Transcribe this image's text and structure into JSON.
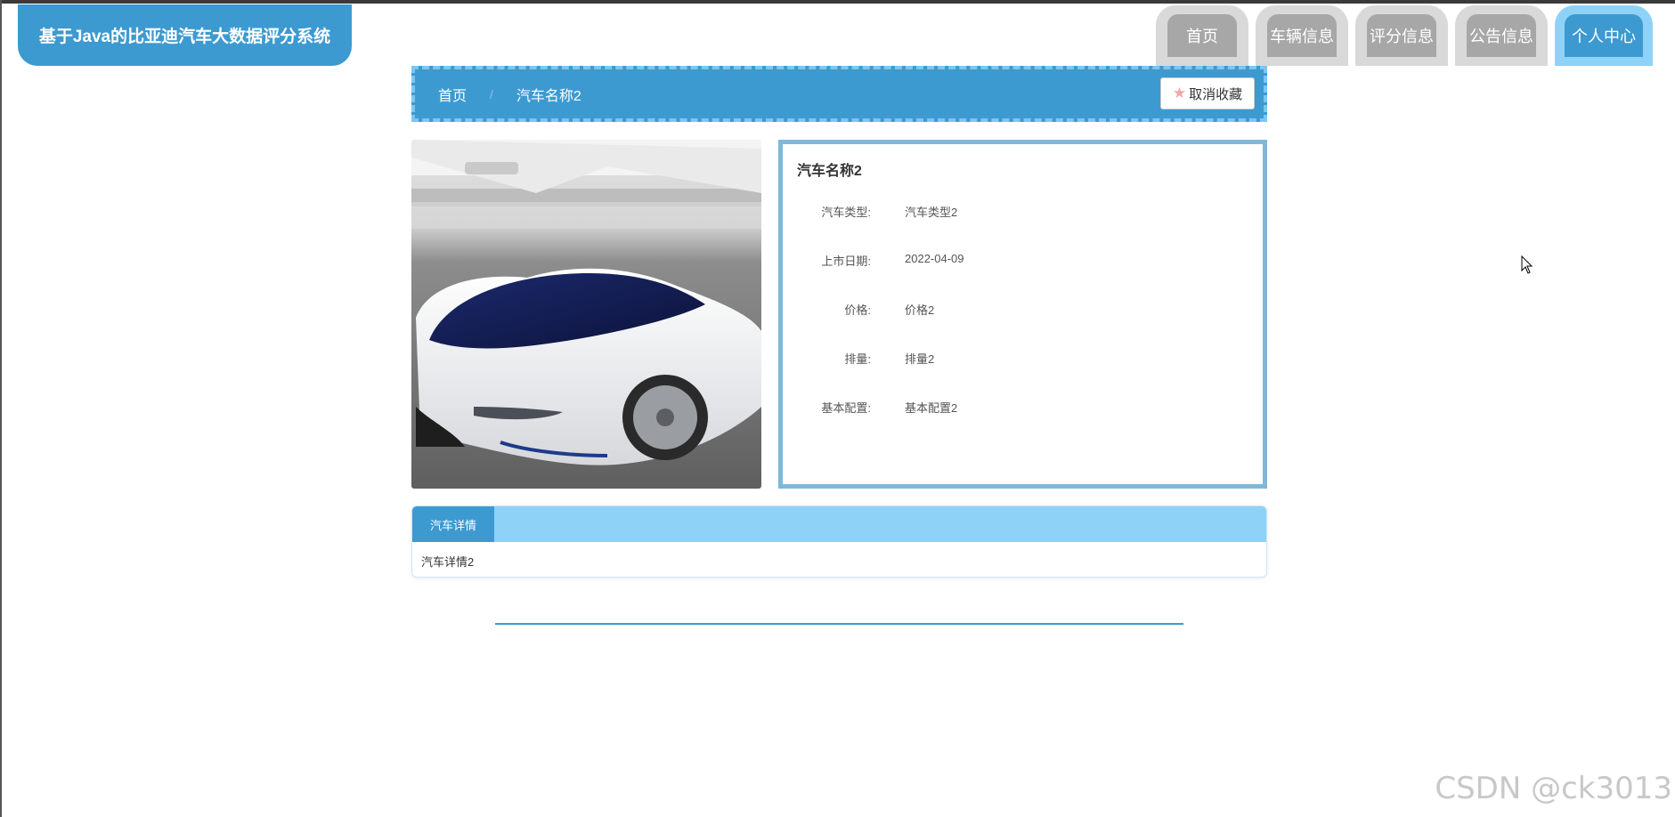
{
  "header": {
    "site_title": "基于Java的比亚迪汽车大数据评分系统",
    "nav": [
      {
        "label": "首页",
        "active": false
      },
      {
        "label": "车辆信息",
        "active": false
      },
      {
        "label": "评分信息",
        "active": false
      },
      {
        "label": "公告信息",
        "active": false
      },
      {
        "label": "个人中心",
        "active": true
      }
    ]
  },
  "breadcrumb": {
    "home": "首页",
    "separator": "/",
    "current": "汽车名称2",
    "favorite_button": "取消收藏",
    "favorite_icon": "star-icon"
  },
  "car": {
    "name": "汽车名称2",
    "image_alt": "white concept sports car",
    "fields": [
      {
        "label": "汽车类型:",
        "value": "汽车类型2"
      },
      {
        "label": "上市日期:",
        "value": "2022-04-09"
      },
      {
        "label": "价格:",
        "value": "价格2"
      },
      {
        "label": "排量:",
        "value": "排量2"
      },
      {
        "label": "基本配置:",
        "value": "基本配置2"
      }
    ]
  },
  "detail": {
    "tab_label": "汽车详情",
    "content": "汽车详情2"
  },
  "watermark": "CSDN @ck3013",
  "colors": {
    "primary": "#3d9ad1",
    "light_primary": "#8fd2f7",
    "tab_gray": "#a7a7a7"
  }
}
